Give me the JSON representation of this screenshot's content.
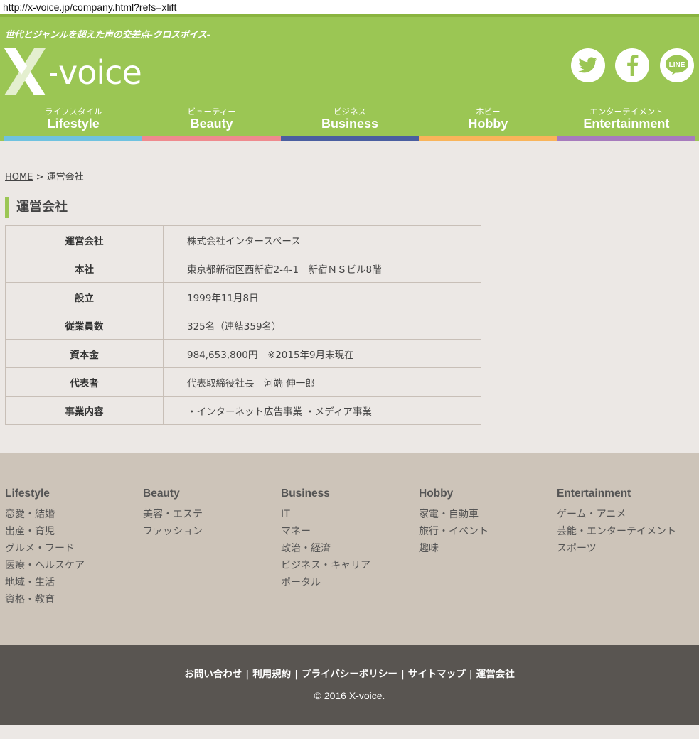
{
  "url": "http://x-voice.jp/company.html?refs=xlift",
  "header": {
    "tagline": "世代とジャンルを超えた声の交差点-クロスボイス-",
    "logo_text": "X-voice",
    "brand_color": "#9bc654",
    "social": [
      {
        "name": "twitter-icon"
      },
      {
        "name": "facebook-icon"
      },
      {
        "name": "line-icon",
        "label": "LINE"
      }
    ]
  },
  "nav": [
    {
      "jp": "ライフスタイル",
      "en": "Lifestyle",
      "color": "#6fc2e0"
    },
    {
      "jp": "ビューティー",
      "en": "Beauty",
      "color": "#ef8a8e"
    },
    {
      "jp": "ビジネス",
      "en": "Business",
      "color": "#4a5ea0"
    },
    {
      "jp": "ホビー",
      "en": "Hobby",
      "color": "#f9b45a"
    },
    {
      "jp": "エンターテイメント",
      "en": "Entertainment",
      "color": "#a77bbd"
    }
  ],
  "breadcrumb": {
    "home": "HOME",
    "sep": ">",
    "current": "運営会社"
  },
  "page_title": "運営会社",
  "table": [
    {
      "key": "運営会社",
      "value": "株式会社インタースペース"
    },
    {
      "key": "本社",
      "value": "東京都新宿区西新宿2-4-1　新宿ＮＳビル8階"
    },
    {
      "key": "設立",
      "value": "1999年11月8日"
    },
    {
      "key": "従業員数",
      "value": "325名（連結359名）"
    },
    {
      "key": "資本金",
      "value": "984,653,800円　※2015年9月末現在"
    },
    {
      "key": "代表者",
      "value": "代表取締役社長　河端 伸一郎"
    },
    {
      "key": "事業内容",
      "value": "・インターネット広告事業 ・メディア事業"
    }
  ],
  "footer_categories": [
    {
      "heading": "Lifestyle",
      "links": [
        "恋愛・結婚",
        "出産・育児",
        "グルメ・フード",
        "医療・ヘルスケア",
        "地域・生活",
        "資格・教育"
      ]
    },
    {
      "heading": "Beauty",
      "links": [
        "美容・エステ",
        "ファッション"
      ]
    },
    {
      "heading": "Business",
      "links": [
        "IT",
        "マネー",
        "政治・経済",
        "ビジネス・キャリア",
        "ポータル"
      ]
    },
    {
      "heading": "Hobby",
      "links": [
        "家電・自動車",
        "旅行・イベント",
        "趣味"
      ]
    },
    {
      "heading": "Entertainment",
      "links": [
        "ゲーム・アニメ",
        "芸能・エンターテイメント",
        "スポーツ"
      ]
    }
  ],
  "footer": {
    "links": [
      "お問い合わせ",
      "利用規約",
      "プライバシーポリシー",
      "サイトマップ",
      "運営会社"
    ],
    "separator": "|",
    "copyright": "© 2016 X-voice."
  }
}
